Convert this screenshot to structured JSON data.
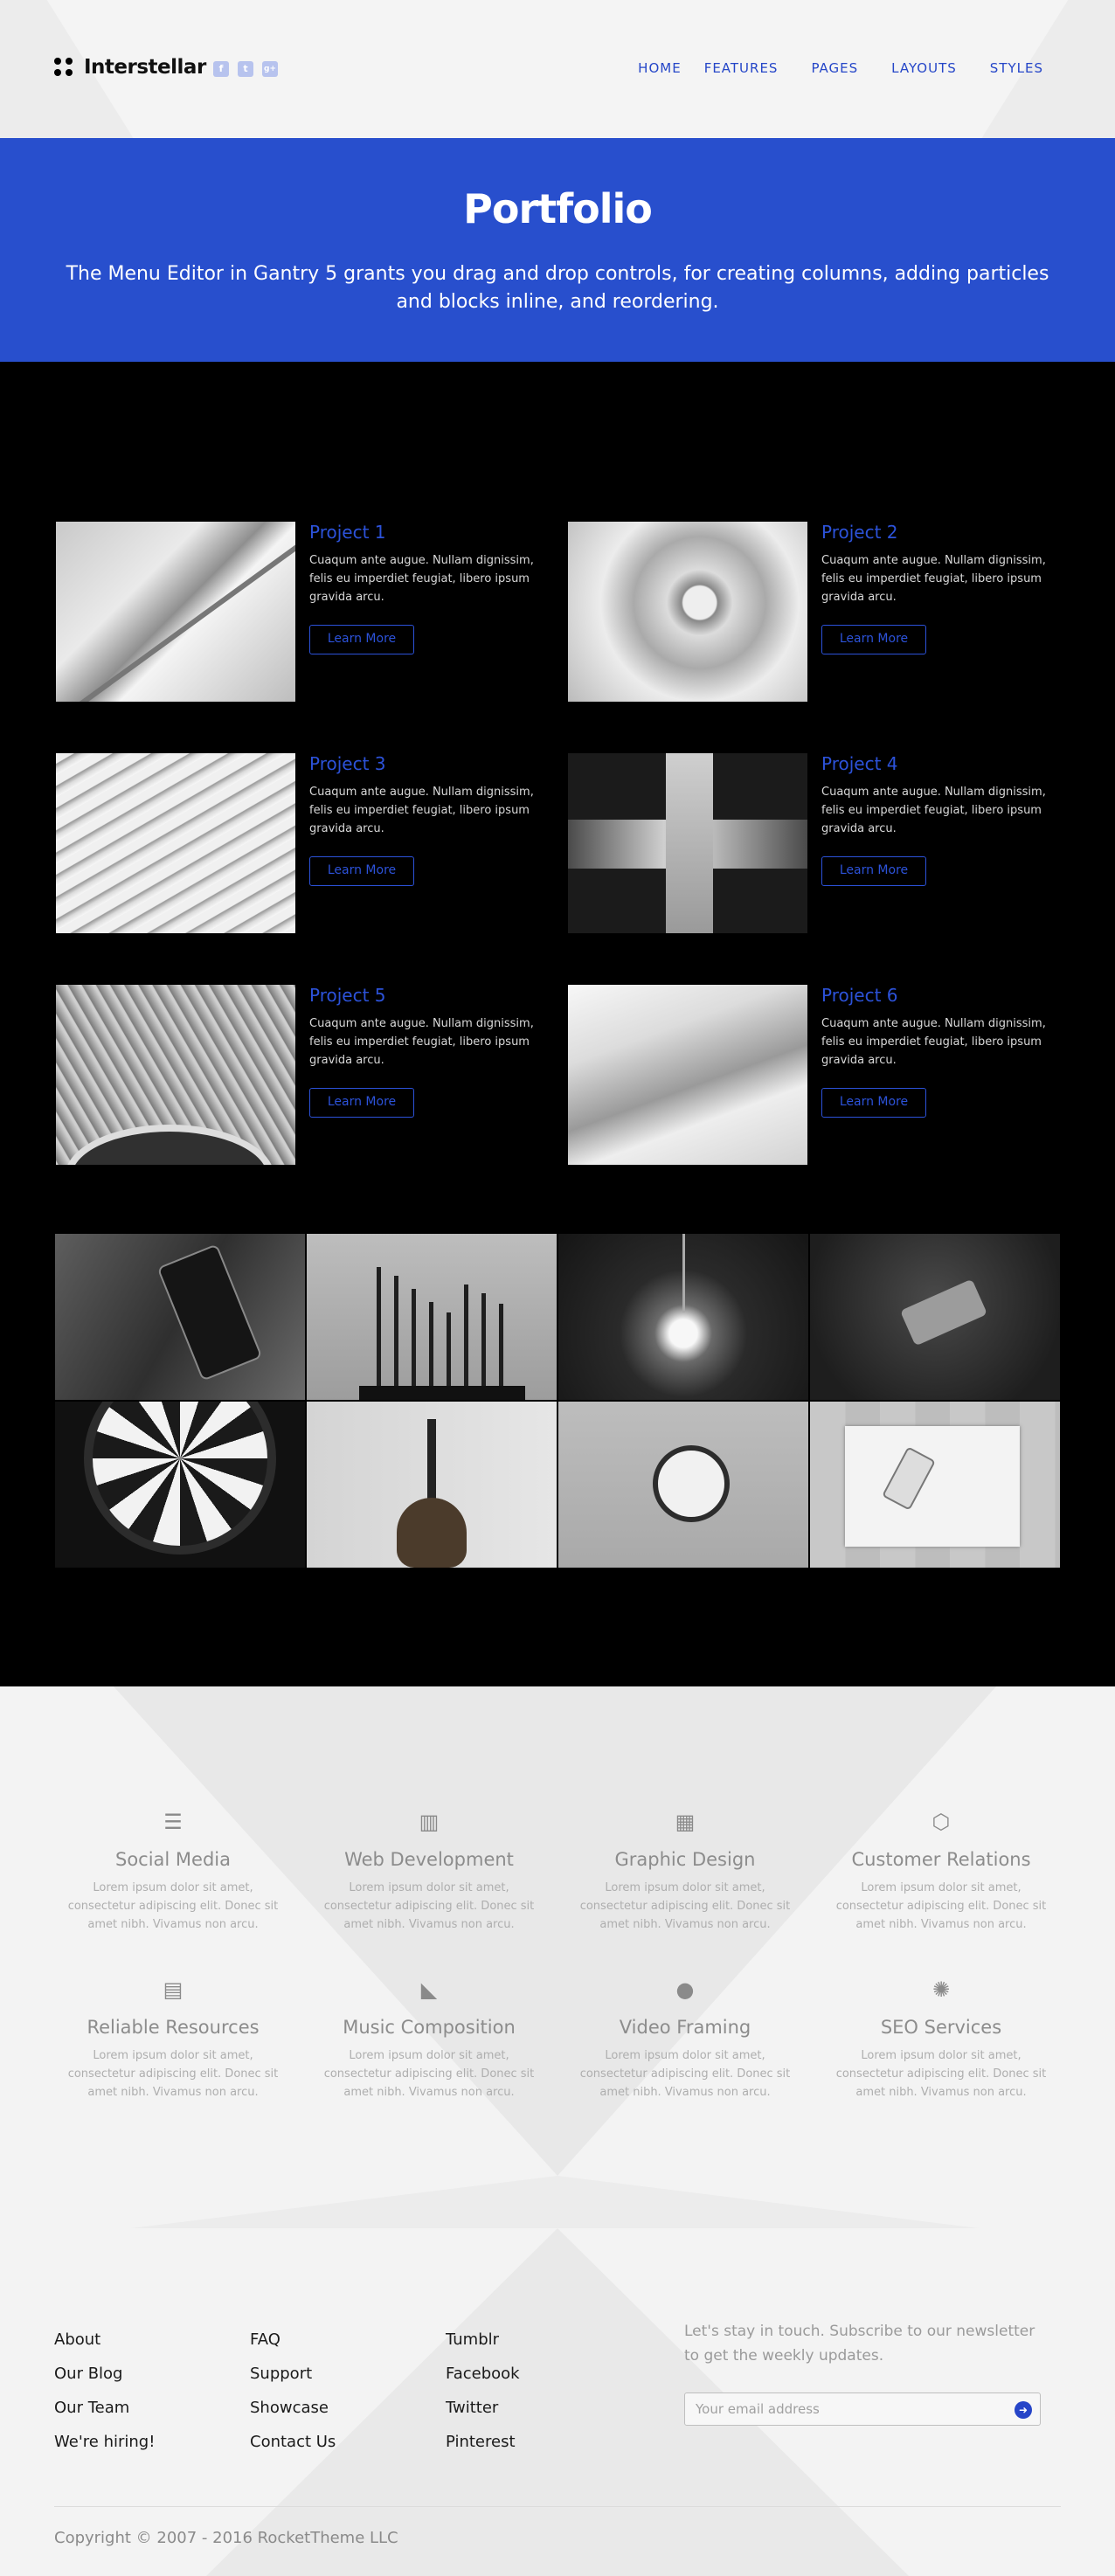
{
  "header": {
    "logo_text": "Interstellar",
    "socials": [
      {
        "icon": "facebook-icon",
        "glyph": "f"
      },
      {
        "icon": "twitter-icon",
        "glyph": "t"
      },
      {
        "icon": "google-plus-icon",
        "glyph": "g+"
      }
    ],
    "nav": [
      "HOME",
      "FEATURES",
      "PAGES",
      "LAYOUTS",
      "STYLES"
    ]
  },
  "hero": {
    "title": "Portfolio",
    "subtitle": "The Menu Editor in Gantry 5 grants you drag and drop controls, for creating columns, adding particles and blocks inline, and reordering."
  },
  "projects": [
    {
      "title": "Project 1",
      "desc": "Cuaqum ante augue. Nullam dignissim, felis eu imperdiet feugiat, libero ipsum gravida arcu.",
      "button": "Learn More"
    },
    {
      "title": "Project 2",
      "desc": "Cuaqum ante augue. Nullam dignissim, felis eu imperdiet feugiat, libero ipsum gravida arcu.",
      "button": "Learn More"
    },
    {
      "title": "Project 3",
      "desc": "Cuaqum ante augue. Nullam dignissim, felis eu imperdiet feugiat, libero ipsum gravida arcu.",
      "button": "Learn More"
    },
    {
      "title": "Project 4",
      "desc": "Cuaqum ante augue. Nullam dignissim, felis eu imperdiet feugiat, libero ipsum gravida arcu.",
      "button": "Learn More"
    },
    {
      "title": "Project 5",
      "desc": "Cuaqum ante augue. Nullam dignissim, felis eu imperdiet feugiat, libero ipsum gravida arcu.",
      "button": "Learn More"
    },
    {
      "title": "Project 6",
      "desc": "Cuaqum ante augue. Nullam dignissim, felis eu imperdiet feugiat, libero ipsum gravida arcu.",
      "button": "Learn More"
    }
  ],
  "gallery": [
    "phone-cable-photo",
    "drill-bits-photo",
    "light-bulb-photo",
    "phones-on-fabric-photo",
    "dartboard-photo",
    "guitar-photo",
    "wall-clock-photo",
    "notebook-phone-photo"
  ],
  "features": [
    {
      "icon": "list-icon",
      "glyph": "☰",
      "title": "Social Media",
      "desc": "Lorem ipsum dolor sit amet, consectetur adipiscing elit. Donec sit amet nibh. Vivamus non arcu."
    },
    {
      "icon": "bar-chart-icon",
      "glyph": "▥",
      "title": "Web Development",
      "desc": "Lorem ipsum dolor sit amet, consectetur adipiscing elit. Donec sit amet nibh. Vivamus non arcu."
    },
    {
      "icon": "building-icon",
      "glyph": "▦",
      "title": "Graphic Design",
      "desc": "Lorem ipsum dolor sit amet, consectetur adipiscing elit. Donec sit amet nibh. Vivamus non arcu."
    },
    {
      "icon": "codepen-icon",
      "glyph": "⬡",
      "title": "Customer Relations",
      "desc": "Lorem ipsum dolor sit amet, consectetur adipiscing elit. Donec sit amet nibh. Vivamus non arcu."
    },
    {
      "icon": "file-image-icon",
      "glyph": "▤",
      "title": "Reliable Resources",
      "desc": "Lorem ipsum dolor sit amet, consectetur adipiscing elit. Donec sit amet nibh. Vivamus non arcu."
    },
    {
      "icon": "industry-icon",
      "glyph": "◣",
      "title": "Music Composition",
      "desc": "Lorem ipsum dolor sit amet, consectetur adipiscing elit. Donec sit amet nibh. Vivamus non arcu."
    },
    {
      "icon": "comments-icon",
      "glyph": "●",
      "title": "Video Framing",
      "desc": "Lorem ipsum dolor sit amet, consectetur adipiscing elit. Donec sit amet nibh. Vivamus non arcu."
    },
    {
      "icon": "empire-icon",
      "glyph": "✺",
      "title": "SEO Services",
      "desc": "Lorem ipsum dolor sit amet, consectetur adipiscing elit. Donec sit amet nibh. Vivamus non arcu."
    }
  ],
  "footer": {
    "col1": [
      "About",
      "Our Blog",
      "Our Team",
      "We're hiring!"
    ],
    "col2": [
      "FAQ",
      "Support",
      "Showcase",
      "Contact Us"
    ],
    "col3": [
      "Tumblr",
      "Facebook",
      "Twitter",
      "Pinterest"
    ],
    "newsletter_text": "Let's stay in touch. Subscribe to our newsletter to get the weekly updates.",
    "email_placeholder": "Your email address",
    "copyright": "Copyright © 2007 - 2016 RocketTheme LLC"
  },
  "colors": {
    "accent": "#284fcd",
    "link": "#2c52d9"
  }
}
